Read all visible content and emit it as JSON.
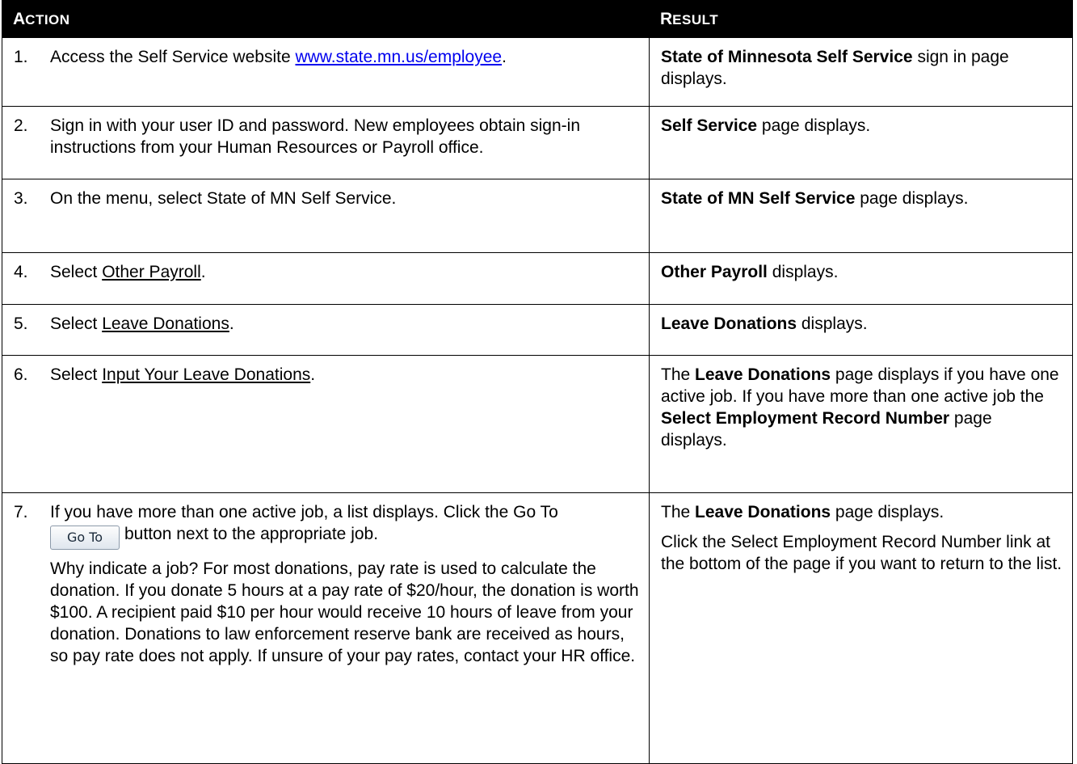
{
  "header": {
    "action_initial": "A",
    "action_rest": "CTION",
    "result_initial": "R",
    "result_rest": "ESULT"
  },
  "steps": [
    {
      "num": "1.",
      "action_pre": "Access the Self Service website ",
      "action_link": "www.state.mn.us/employee",
      "action_post": ".",
      "result_bold": "State of Minnesota Self Service",
      "result_rest": " sign in page displays."
    },
    {
      "num": "2.",
      "action": "Sign in with your user ID and password. New employees obtain sign-in instructions from your Human Resources or Payroll office.",
      "result_bold": "Self Service",
      "result_rest": " page displays."
    },
    {
      "num": "3.",
      "action": "On the menu, select State of MN Self Service.",
      "result_bold": "State of MN Self Service",
      "result_rest": " page displays."
    },
    {
      "num": "4.",
      "action_pre": "Select ",
      "action_link": "Other Payroll",
      "action_post": ".",
      "result_bold": "Other Payroll",
      "result_rest": " displays."
    },
    {
      "num": "5.",
      "action_pre": "Select ",
      "action_link": "Leave Donations",
      "action_post": ".",
      "result_bold": "Leave Donations",
      "result_rest": " displays."
    },
    {
      "num": "6.",
      "action_pre": "Select ",
      "action_link": "Input Your Leave Donations",
      "action_post": ".",
      "result_pre": "The ",
      "result_bold": "Leave Donations",
      "result_mid": " page displays if you have one active job. If you have more than one active job the ",
      "result_bold2": "Select Employment Record Number",
      "result_rest": " page displays."
    },
    {
      "num": "7.",
      "action_line1": "If you have more than one active job, a list displays. Click the Go To",
      "button_label": "Go To",
      "action_line2": "button next to the appropriate job.",
      "action_para2": "Why indicate a job? For most donations, pay rate is used to calculate the donation. If you donate 5 hours at a pay rate of $20/hour, the donation is worth $100. A recipient paid $10 per hour would receive 10 hours of leave from your donation. Donations to law enforcement reserve bank are received as hours, so pay rate does not apply. If unsure of your pay rates, contact your HR office.",
      "result_pre": "The ",
      "result_bold": "Leave Donations",
      "result_rest": " page displays.",
      "result_para2": "Click the Select Employment Record Number link at the bottom of the page if you want to return to the list."
    }
  ],
  "colors": {
    "header_bg": "#000000",
    "header_text": "#ffffff",
    "link": "#0000ee"
  }
}
